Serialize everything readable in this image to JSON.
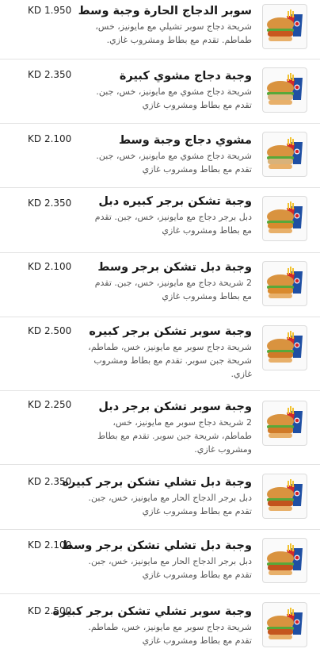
{
  "currency": "KD",
  "items": [
    {
      "name": "سوبر الدجاج الحارة وجبة وسط",
      "desc": "شريحة دجاج سوبر تشيلي مع مايونيز، خس، طماطم. تقدم مع بطاط ومشروب غازي.",
      "price": "1.950",
      "image": "spicy-chicken-meal-image"
    },
    {
      "name": "وجبة دجاج مشوي كبيرة",
      "desc": "شريحة دجاج مشوي مع مايونيز، خس، جبن. تقدم مع بطاط ومشروب غازي",
      "price": "2.350",
      "image": "grilled-chicken-meal-image"
    },
    {
      "name": "مشوي دجاج وجبة وسط",
      "desc": "شريحة دجاج مشوي مع مايونيز، خس، جبن. تقدم مع بطاط ومشروب غازي",
      "price": "2.100",
      "image": "grilled-chicken-meal-image"
    },
    {
      "name": "وجبة تشكن برجر كبيره دبل",
      "desc": "دبل برجر دجاج مع مايونيز، خس، جبن. تقدم مع بطاط ومشروب غازي",
      "price": "2.350",
      "image": "chicken-burger-meal-image"
    },
    {
      "name": "وجبة دبل تشكن برجر وسط",
      "desc": "2 شريحة دجاج مع مايونيز، خس، جبن. تقدم مع بطاط ومشروب غازي",
      "price": "2.100",
      "image": "chicken-burger-meal-image"
    },
    {
      "name": "وجبة سوبر تشكن برجر كبيره",
      "desc": "شريحة دجاج سوبر مع مايونيز، خس، طماطم، شريحة جبن سوبر. تقدم مع بطاط ومشروب غازي.",
      "price": "2.500",
      "image": "super-chicken-burger-image"
    },
    {
      "name": "وجبة سوبر تشكن برجر دبل",
      "desc": "2 شريحة دجاج سوبر مع مايونيز، خس، طماطم، شريحة جبن سوبر. تقدم مع بطاط ومشروب غازي.",
      "price": "2.250",
      "image": "super-chicken-burger-image"
    },
    {
      "name": "وجبة دبل تشلي تشكن برجر كبيره",
      "desc": "دبل برجر الدجاج الحار مع مايونيز، خس، جبن. تقدم مع بطاط ومشروب غازي",
      "price": "2.350",
      "image": "double-chili-chicken-image"
    },
    {
      "name": "وجبة دبل تشلي تشكن برجر وسط",
      "desc": "دبل برجر الدجاج الحار مع مايونيز، خس، جبن. تقدم مع بطاط ومشروب غازي",
      "price": "2.100",
      "image": "double-chili-chicken-image"
    },
    {
      "name": "وجبة سوبر تشلي تشكن برجر كبيره",
      "desc": "شريحة دجاج سوبر مع مايونيز، خس، طماطم. تقدم مع بطاط ومشروب غازي",
      "price": "2.500",
      "image": "super-chili-chicken-image"
    }
  ]
}
